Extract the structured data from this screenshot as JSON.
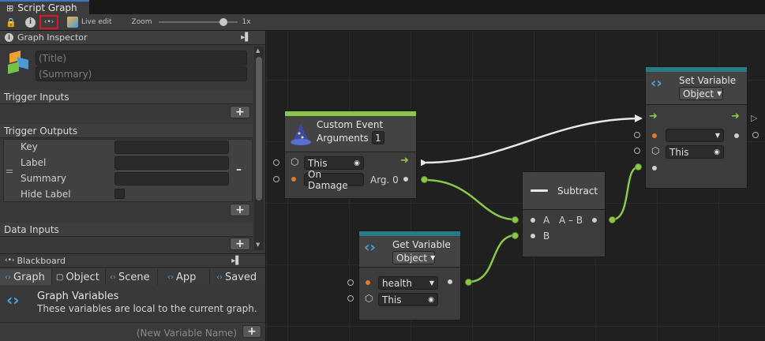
{
  "window": {
    "tab_title": "Script Graph"
  },
  "toolbar": {
    "live_edit": "Live edit",
    "zoom_label": "Zoom",
    "zoom_value": "1x",
    "zoom_fraction": 0.85
  },
  "inspector": {
    "header": "Graph Inspector",
    "title_placeholder": "(Title)",
    "summary_placeholder": "(Summary)",
    "trigger_inputs": "Trigger Inputs",
    "trigger_outputs": "Trigger Outputs",
    "fields": {
      "key": "Key",
      "label": "Label",
      "summary": "Summary",
      "hide_label": "Hide Label"
    },
    "data_inputs": "Data Inputs",
    "plus": "+",
    "minus": "–"
  },
  "blackboard": {
    "header": "Blackboard",
    "tabs": [
      "Graph",
      "Object",
      "Scene",
      "App",
      "Saved"
    ],
    "heading": "Graph Variables",
    "description": "These variables are local to the current graph.",
    "new_var_placeholder": "(New Variable Name)"
  },
  "nodes": {
    "custom_event": {
      "title": "Custom Event",
      "args_label": "Arguments",
      "args_value": "1",
      "this": "This",
      "event_name": "On Damage",
      "arg0": "Arg. 0"
    },
    "get_variable": {
      "title": "Get Variable",
      "kind": "Object",
      "name": "health",
      "this": "This"
    },
    "subtract": {
      "title": "Subtract",
      "a": "A",
      "b": "B",
      "out": "A – B"
    },
    "set_variable": {
      "title": "Set Variable",
      "kind": "Object",
      "this": "This"
    }
  },
  "colors": {
    "accent_green": "#8bc84a",
    "accent_teal": "#277b85",
    "highlight_red": "#e0151d"
  }
}
